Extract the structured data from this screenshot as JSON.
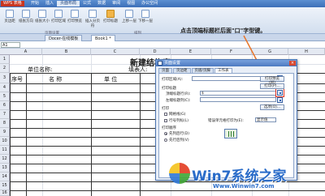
{
  "app": {
    "logo": "WPS 表格"
  },
  "menu": [
    "开始",
    "插入",
    "页面布局",
    "公式",
    "数据",
    "审阅",
    "视图",
    "办公空间"
  ],
  "ribbon": {
    "buttons": [
      "页边距",
      "纸张方向",
      "纸张大小",
      "打印区域",
      "打印预览",
      "插入分页符",
      "打印标题",
      "上移一层",
      "下移一层"
    ],
    "group_labels": [
      "页面设置",
      "排列"
    ]
  },
  "doc_tabs": [
    "Docer-在线模板",
    "Book1 *"
  ],
  "namebox": "A1",
  "sheet": {
    "columns": [
      "A",
      "B",
      "C",
      "D",
      "E",
      "F",
      "G",
      "H"
    ],
    "rows": [
      "1",
      "2",
      "3",
      "4",
      "5",
      "6",
      "7",
      "8",
      "9",
      "10",
      "11",
      "12",
      "13",
      "14",
      "15",
      "16"
    ],
    "title": "新建结构表",
    "unit_label": "单位名称:",
    "reporter_label": "填表人:",
    "headers": {
      "seq": "序号",
      "name": "名 称",
      "unit": "单 位"
    }
  },
  "dialog": {
    "title": "页面设置",
    "tabs": [
      "页面",
      "页边距",
      "页眉/页脚",
      "工作表"
    ],
    "print_area_label": "打印区域(A):",
    "print_titles_label": "打印标题",
    "top_title_label": "顶端标题行(R):",
    "top_title_value": "$",
    "left_title_label": "左端标题列(C):",
    "print_label": "打印",
    "gridlines_label": "网格线(G)",
    "rowcol_label": "行号列标(L)",
    "comments_label": "批注",
    "errors_label": "错误单元格打印为(E):",
    "errors_value": "显示值",
    "order_label": "打印顺序",
    "order_down": "先列后行(D)",
    "order_over": "先行后列(V)",
    "print_button": "打印(P)...",
    "preview_button": "打印预览(W)",
    "options_button": "选项(O)..."
  },
  "callout": "点击顶端标题栏后面\"口\"字型键。",
  "watermark": {
    "brand": "Win7系统之家",
    "url": "Www.Winwin7.com"
  }
}
